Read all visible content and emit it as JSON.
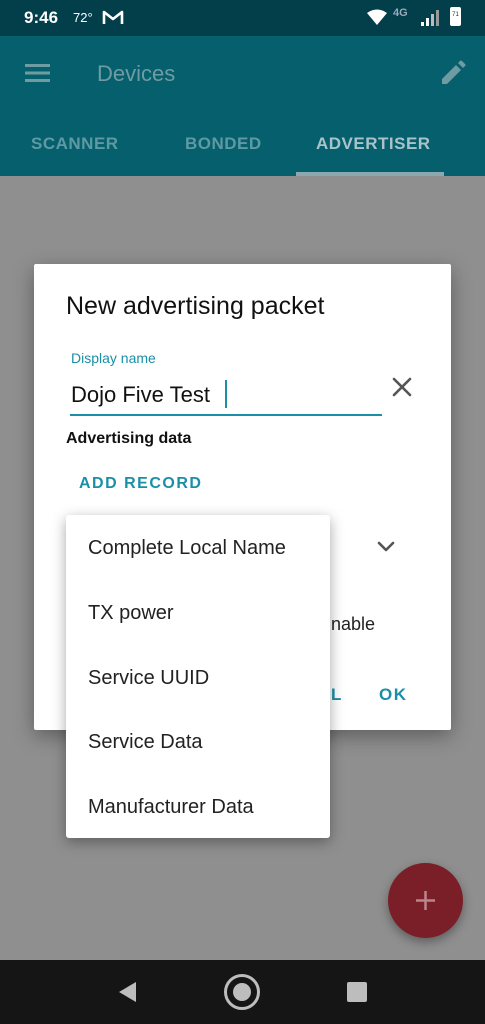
{
  "status_bar": {
    "time": "9:46",
    "temperature": "72°",
    "mail_icon": "gmail-icon",
    "network": "4G",
    "battery_level": "71"
  },
  "app_bar": {
    "title": "Devices"
  },
  "tabs": [
    {
      "label": "SCANNER"
    },
    {
      "label": "BONDED"
    },
    {
      "label": "ADVERTISER"
    }
  ],
  "dialog": {
    "title": "New advertising packet",
    "display_name_label": "Display name",
    "display_name_value": "Dojo Five Test",
    "advertising_data_label": "Advertising data",
    "add_record_label": "ADD RECORD",
    "partial_option_text": "nable",
    "cancel_partial": "L",
    "ok_label": "OK"
  },
  "dropdown_menu": {
    "items": [
      {
        "label": "Complete Local Name"
      },
      {
        "label": "TX power"
      },
      {
        "label": "Service UUID"
      },
      {
        "label": "Service Data"
      },
      {
        "label": "Manufacturer Data"
      }
    ]
  },
  "colors": {
    "status_bar": "#033f4a",
    "app_bar": "#055f6d",
    "accent": "#1a8fa8",
    "fab": "#7a1f27"
  }
}
